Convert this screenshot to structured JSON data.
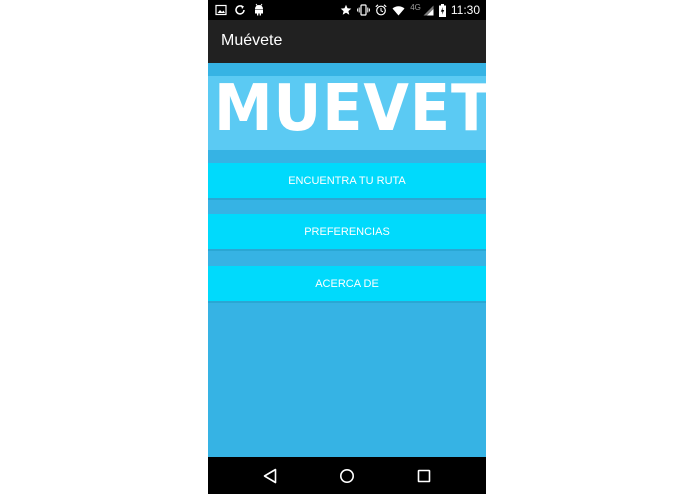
{
  "status_bar": {
    "left_icons": [
      "image-notification-icon",
      "sync-icon",
      "android-debug-icon"
    ],
    "right_icons": [
      "star-icon",
      "vibrate-icon",
      "alarm-icon",
      "wifi-icon",
      "cell-signal-icon",
      "battery-charging-icon"
    ],
    "network_type": "4G",
    "time": "11:30"
  },
  "app_bar": {
    "title": "Muévete"
  },
  "logo": {
    "text": "MUEVETE"
  },
  "menu": {
    "find_route_label": "ENCUENTRA TU RUTA",
    "preferences_label": "PREFERENCIAS",
    "about_label": "ACERCA DE"
  },
  "nav_bar": {
    "icons": [
      "back-icon",
      "home-icon",
      "recents-icon"
    ]
  },
  "colors": {
    "background": "#36b3e4",
    "logo_band": "#5bcaf3",
    "button": "#00dafc",
    "app_bar": "#212121",
    "status_bar": "#000000"
  }
}
